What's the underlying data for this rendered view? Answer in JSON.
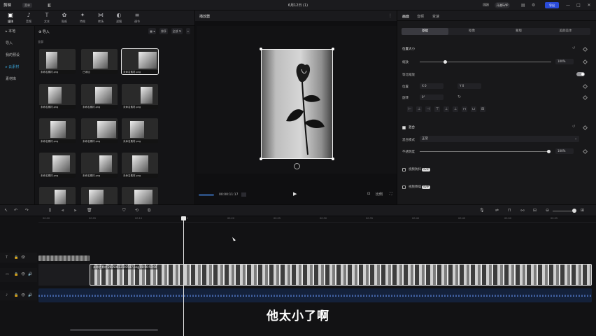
{
  "titlebar": {
    "app_name": "剪映",
    "menu_label": "菜单",
    "doc_title": "6月12日 (1)",
    "pro_label": "开通SVIP",
    "export_label": "导出",
    "minimize": "—",
    "maximize": "□",
    "close": "✕"
  },
  "media_tabs": [
    {
      "icon": "▣",
      "label": "媒体"
    },
    {
      "icon": "♪",
      "label": "音频"
    },
    {
      "icon": "T",
      "label": "文本"
    },
    {
      "icon": "✿",
      "label": "贴纸"
    },
    {
      "icon": "✦",
      "label": "特效"
    },
    {
      "icon": "⋈",
      "label": "转场"
    },
    {
      "icon": "◐",
      "label": "滤镜"
    },
    {
      "icon": "≡",
      "label": "调节"
    }
  ],
  "sidenav": [
    {
      "label": "▸ 本地",
      "active": false
    },
    {
      "label": "导入",
      "active": false
    },
    {
      "label": "我的预设",
      "active": false
    },
    {
      "label": "▸ 云素材",
      "active": true
    },
    {
      "label": "素材库",
      "active": false
    }
  ],
  "media": {
    "import_label": "导入",
    "tool_view": "▦ ▾",
    "tool_sort": "排序",
    "tool_all": "全部 ⇅",
    "section_label": "全部",
    "thumbs": [
      {
        "caption": "未命名素材.png",
        "added": false
      },
      {
        "caption": "已添加",
        "added": true
      },
      {
        "caption": "未命名素材.png",
        "added": false
      },
      {
        "caption": "未命名素材.png",
        "added": false
      },
      {
        "caption": "未命名素材.png",
        "added": false
      },
      {
        "caption": "未命名素材.png",
        "added": false
      },
      {
        "caption": "未命名素材.png",
        "added": false
      },
      {
        "caption": "未命名素材.png",
        "added": false
      },
      {
        "caption": "未命名素材.png",
        "added": false
      },
      {
        "caption": "未命名素材.png",
        "added": false
      },
      {
        "caption": "未命名素材.png",
        "added": false
      },
      {
        "caption": "未命名素材.png",
        "added": false
      },
      {
        "caption": "",
        "added": false
      },
      {
        "caption": "",
        "added": false
      },
      {
        "caption": "",
        "added": false
      }
    ]
  },
  "player": {
    "title": "播放器",
    "timecode": "00:00:11:17",
    "ratio": "比例",
    "fullscreen": "⛶"
  },
  "inspector": {
    "tabs": [
      "画面",
      "音频",
      "变速"
    ],
    "sub_tabs": [
      "基础",
      "抠像",
      "蒙版",
      "美颜美体"
    ],
    "scale_section": "位置大小",
    "scale_label": "缩放",
    "scale_value": "100%",
    "uniform_label": "等比缩放",
    "position_label": "位置",
    "pos_x": "X  0",
    "pos_y": "Y  0",
    "rotate_label": "旋转",
    "rotate_value": "0°",
    "blend_section": "混合",
    "blend_mode_label": "混合模式",
    "blend_mode_value": "正常",
    "opacity_label": "不透明度",
    "opacity_value": "100%",
    "stabilize_label": "视频防抖",
    "denoise_label": "视频降噪",
    "vip_badge": "SVIP"
  },
  "timeline": {
    "ruler_ticks": [
      "00:00",
      "00:05",
      "00:10",
      "00:15",
      "00:20",
      "00:25",
      "00:30",
      "00:35",
      "00:40",
      "00:45",
      "00:50",
      "00:55",
      "01:00"
    ],
    "clip_label": "未命名素材 20250612193547.png  00:00:50:00",
    "subtitle": "他太小了啊"
  }
}
